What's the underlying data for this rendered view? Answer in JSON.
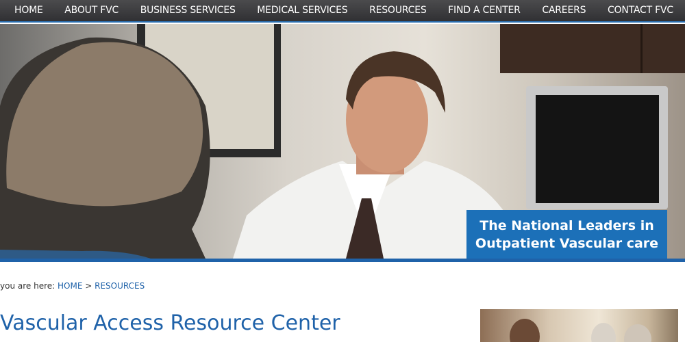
{
  "nav": {
    "items": [
      {
        "label": "HOME"
      },
      {
        "label": "ABOUT FVC"
      },
      {
        "label": "BUSINESS SERVICES"
      },
      {
        "label": "MEDICAL SERVICES"
      },
      {
        "label": "RESOURCES"
      },
      {
        "label": "FIND A CENTER"
      },
      {
        "label": "CAREERS"
      },
      {
        "label": "CONTACT FVC"
      }
    ]
  },
  "hero": {
    "tagline_line1": "The National Leaders in",
    "tagline_line2": "Outpatient Vascular care"
  },
  "breadcrumb": {
    "prefix": "you are here:",
    "home": "HOME",
    "separator": ">",
    "current": "RESOURCES"
  },
  "page": {
    "title": "Vascular Access Resource Center"
  },
  "colors": {
    "accent": "#1f62a9",
    "tagline_bg": "#1c70b8",
    "nav_bg": "#3c3c3e"
  }
}
